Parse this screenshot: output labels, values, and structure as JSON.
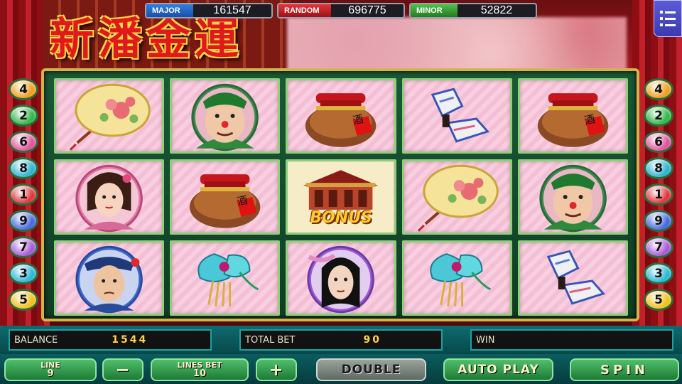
{
  "game": {
    "title": "新潘金運"
  },
  "jackpots": {
    "major": {
      "label": "MAJOR",
      "value": "161547"
    },
    "random": {
      "label": "RANDOM",
      "value": "696775"
    },
    "minor": {
      "label": "MINOR",
      "value": "52822"
    }
  },
  "menu": {
    "icon": "menu-list-icon"
  },
  "reels": {
    "rows": [
      [
        {
          "symbol": "peony-fan"
        },
        {
          "symbol": "fat-man-portrait"
        },
        {
          "symbol": "wine-jar",
          "jar_text": "酒"
        },
        {
          "symbol": "embroidered-shoes"
        },
        {
          "symbol": "wine-jar",
          "jar_text": "酒"
        }
      ],
      [
        {
          "symbol": "lady-portrait"
        },
        {
          "symbol": "wine-jar",
          "jar_text": "酒"
        },
        {
          "symbol": "bonus-house",
          "label": "BONUS"
        },
        {
          "symbol": "peony-fan"
        },
        {
          "symbol": "fat-man-portrait"
        }
      ],
      [
        {
          "symbol": "young-man-portrait"
        },
        {
          "symbol": "jade-hairpin"
        },
        {
          "symbol": "scholar-portrait"
        },
        {
          "symbol": "jade-hairpin"
        },
        {
          "symbol": "embroidered-shoes"
        }
      ]
    ]
  },
  "line_markers": {
    "left": [
      "4",
      "2",
      "6",
      "8",
      "1",
      "9",
      "7",
      "3",
      "5"
    ],
    "right": [
      "4",
      "2",
      "6",
      "8",
      "1",
      "9",
      "7",
      "3",
      "5"
    ],
    "colors": [
      "#f0a020",
      "#35b84a",
      "#e0559c",
      "#31b4cf",
      "#e0383e",
      "#4a6be0",
      "#a85ad8",
      "#2fb7d8",
      "#f0c21e"
    ]
  },
  "info": {
    "balance_label": "BALANCE",
    "balance_value": "1544",
    "total_bet_label": "TOTAL BET",
    "total_bet_value": "90",
    "win_label": "WIN",
    "win_value": ""
  },
  "controls": {
    "line_label": "LINE",
    "line_value": "9",
    "minus": "−",
    "lines_bet_label": "LINES BET",
    "lines_bet_value": "10",
    "plus": "+",
    "double": "DOUBLE",
    "auto_play": "AUTO PLAY",
    "spin": "SPIN"
  }
}
